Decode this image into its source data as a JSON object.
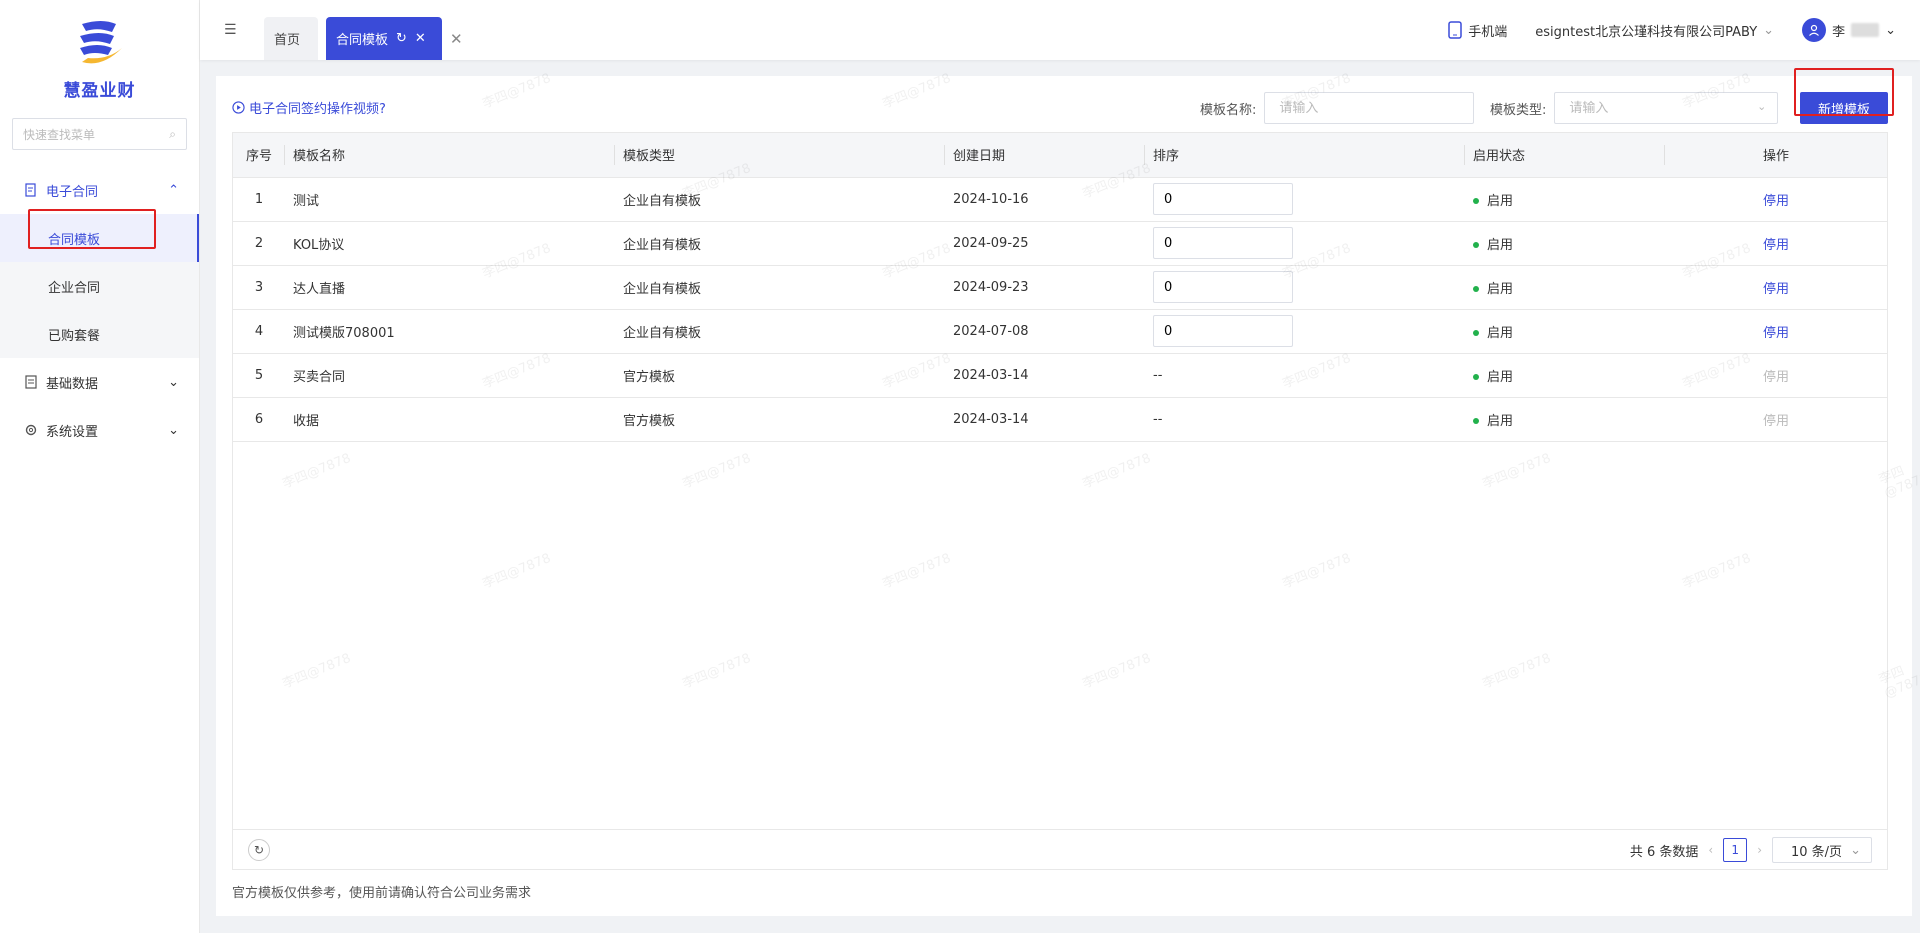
{
  "sidebar": {
    "app_name": "慧盈业财",
    "search_placeholder": "快速查找菜单",
    "groups": [
      {
        "label": "电子合同",
        "items": [
          "合同模板",
          "企业合同",
          "已购套餐"
        ]
      },
      {
        "label": "基础数据"
      },
      {
        "label": "系统设置"
      }
    ]
  },
  "header": {
    "tabs": [
      {
        "label": "首页"
      },
      {
        "label": "合同模板"
      }
    ],
    "mobile_label": "手机端",
    "company": "esigntest北京公瑾科技有限公司PABY",
    "user_initial": "李"
  },
  "toolbar": {
    "video_link": "电子合同签约操作视频?",
    "filter_name_label": "模板名称:",
    "filter_name_placeholder": "请输入",
    "filter_type_label": "模板类型:",
    "filter_type_placeholder": "请输入",
    "add_button": "新增模板"
  },
  "table": {
    "columns": [
      "序号",
      "模板名称",
      "模板类型",
      "创建日期",
      "排序",
      "启用状态",
      "操作"
    ],
    "rows": [
      {
        "no": "1",
        "name": "测试",
        "type": "企业自有模板",
        "date": "2024-10-16",
        "sort": "0",
        "status": "启用",
        "op": "停用",
        "op_enabled": true
      },
      {
        "no": "2",
        "name": "KOL协议",
        "type": "企业自有模板",
        "date": "2024-09-25",
        "sort": "0",
        "status": "启用",
        "op": "停用",
        "op_enabled": true
      },
      {
        "no": "3",
        "name": "达人直播",
        "type": "企业自有模板",
        "date": "2024-09-23",
        "sort": "0",
        "status": "启用",
        "op": "停用",
        "op_enabled": true
      },
      {
        "no": "4",
        "name": "测试模版708001",
        "type": "企业自有模板",
        "date": "2024-07-08",
        "sort": "0",
        "status": "启用",
        "op": "停用",
        "op_enabled": true
      },
      {
        "no": "5",
        "name": "买卖合同",
        "type": "官方模板",
        "date": "2024-03-14",
        "sort": "--",
        "status": "启用",
        "op": "停用",
        "op_enabled": false
      },
      {
        "no": "6",
        "name": "收据",
        "type": "官方模板",
        "date": "2024-03-14",
        "sort": "--",
        "status": "启用",
        "op": "停用",
        "op_enabled": false
      }
    ]
  },
  "pager": {
    "total": "共 6 条数据",
    "page": "1",
    "size": "10 条/页"
  },
  "footer_note": "官方模板仅供参考，使用前请确认符合公司业务需求",
  "watermark_text": "李四@7878",
  "colors": {
    "accent": "#3a4bd8",
    "status_dot": "#22b14c",
    "highlight": "#e02020"
  }
}
